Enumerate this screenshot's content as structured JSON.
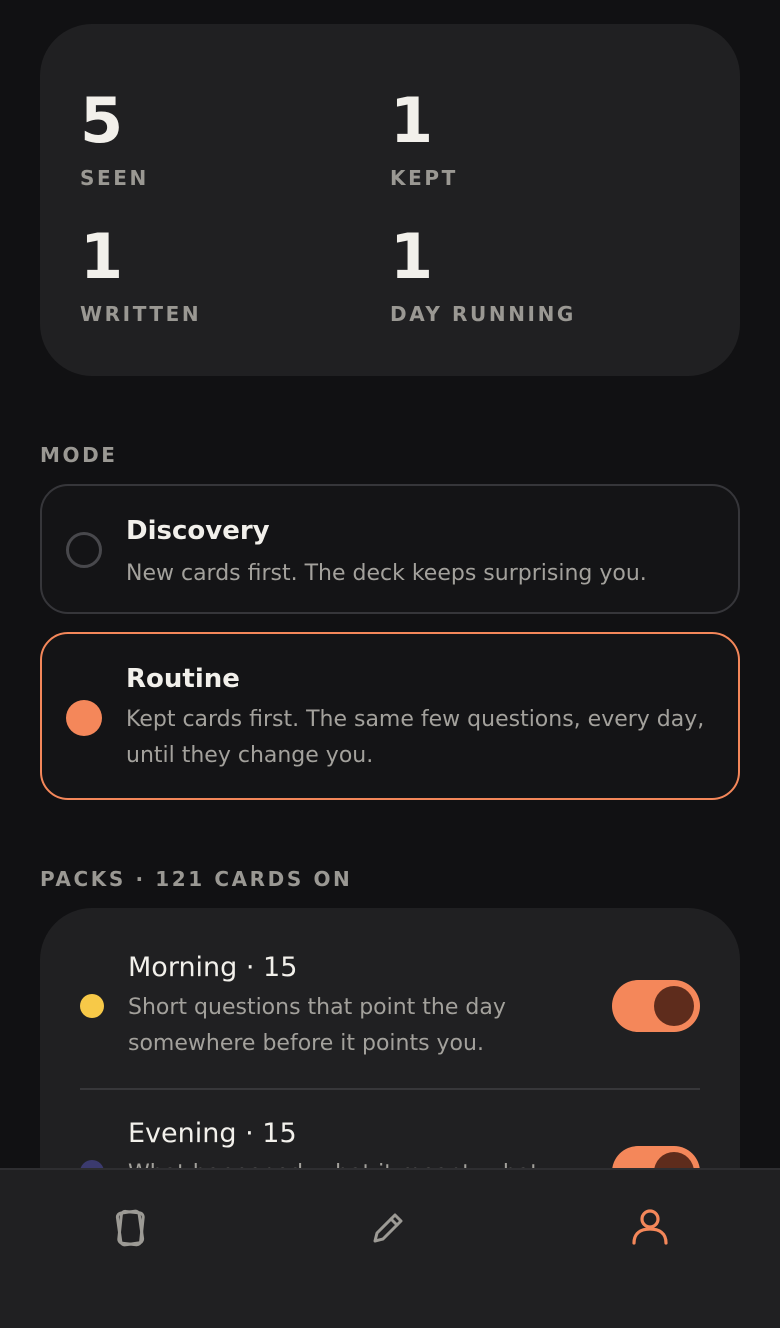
{
  "stats": [
    {
      "value": "5",
      "label": "SEEN"
    },
    {
      "value": "1",
      "label": "KEPT"
    },
    {
      "value": "1",
      "label": "WRITTEN"
    },
    {
      "value": "1",
      "label": "DAY RUNNING"
    }
  ],
  "mode": {
    "section_label": "MODE",
    "options": [
      {
        "title": "Discovery",
        "description": "New cards first. The deck keeps surprising you.",
        "selected": false
      },
      {
        "title": "Routine",
        "description": "Kept cards first. The same few questions, every day, until they change you.",
        "selected": true
      }
    ]
  },
  "packs": {
    "section_label": "PACKS · 121 CARDS ON",
    "items": [
      {
        "title": "Morning · 15",
        "description": "Short questions that point the day somewhere before it points you.",
        "dot_color": "#F7C948",
        "enabled": true
      },
      {
        "title": "Evening · 15",
        "description": "What happened, what it meant, what",
        "dot_color": "#3B3A6E",
        "enabled": true
      }
    ]
  },
  "nav": {
    "items": [
      {
        "icon": "cards-icon",
        "active": false
      },
      {
        "icon": "pencil-icon",
        "active": false
      },
      {
        "icon": "profile-icon",
        "active": true
      }
    ]
  },
  "colors": {
    "accent": "#F4875A",
    "background": "#111113",
    "card": "#202022"
  }
}
